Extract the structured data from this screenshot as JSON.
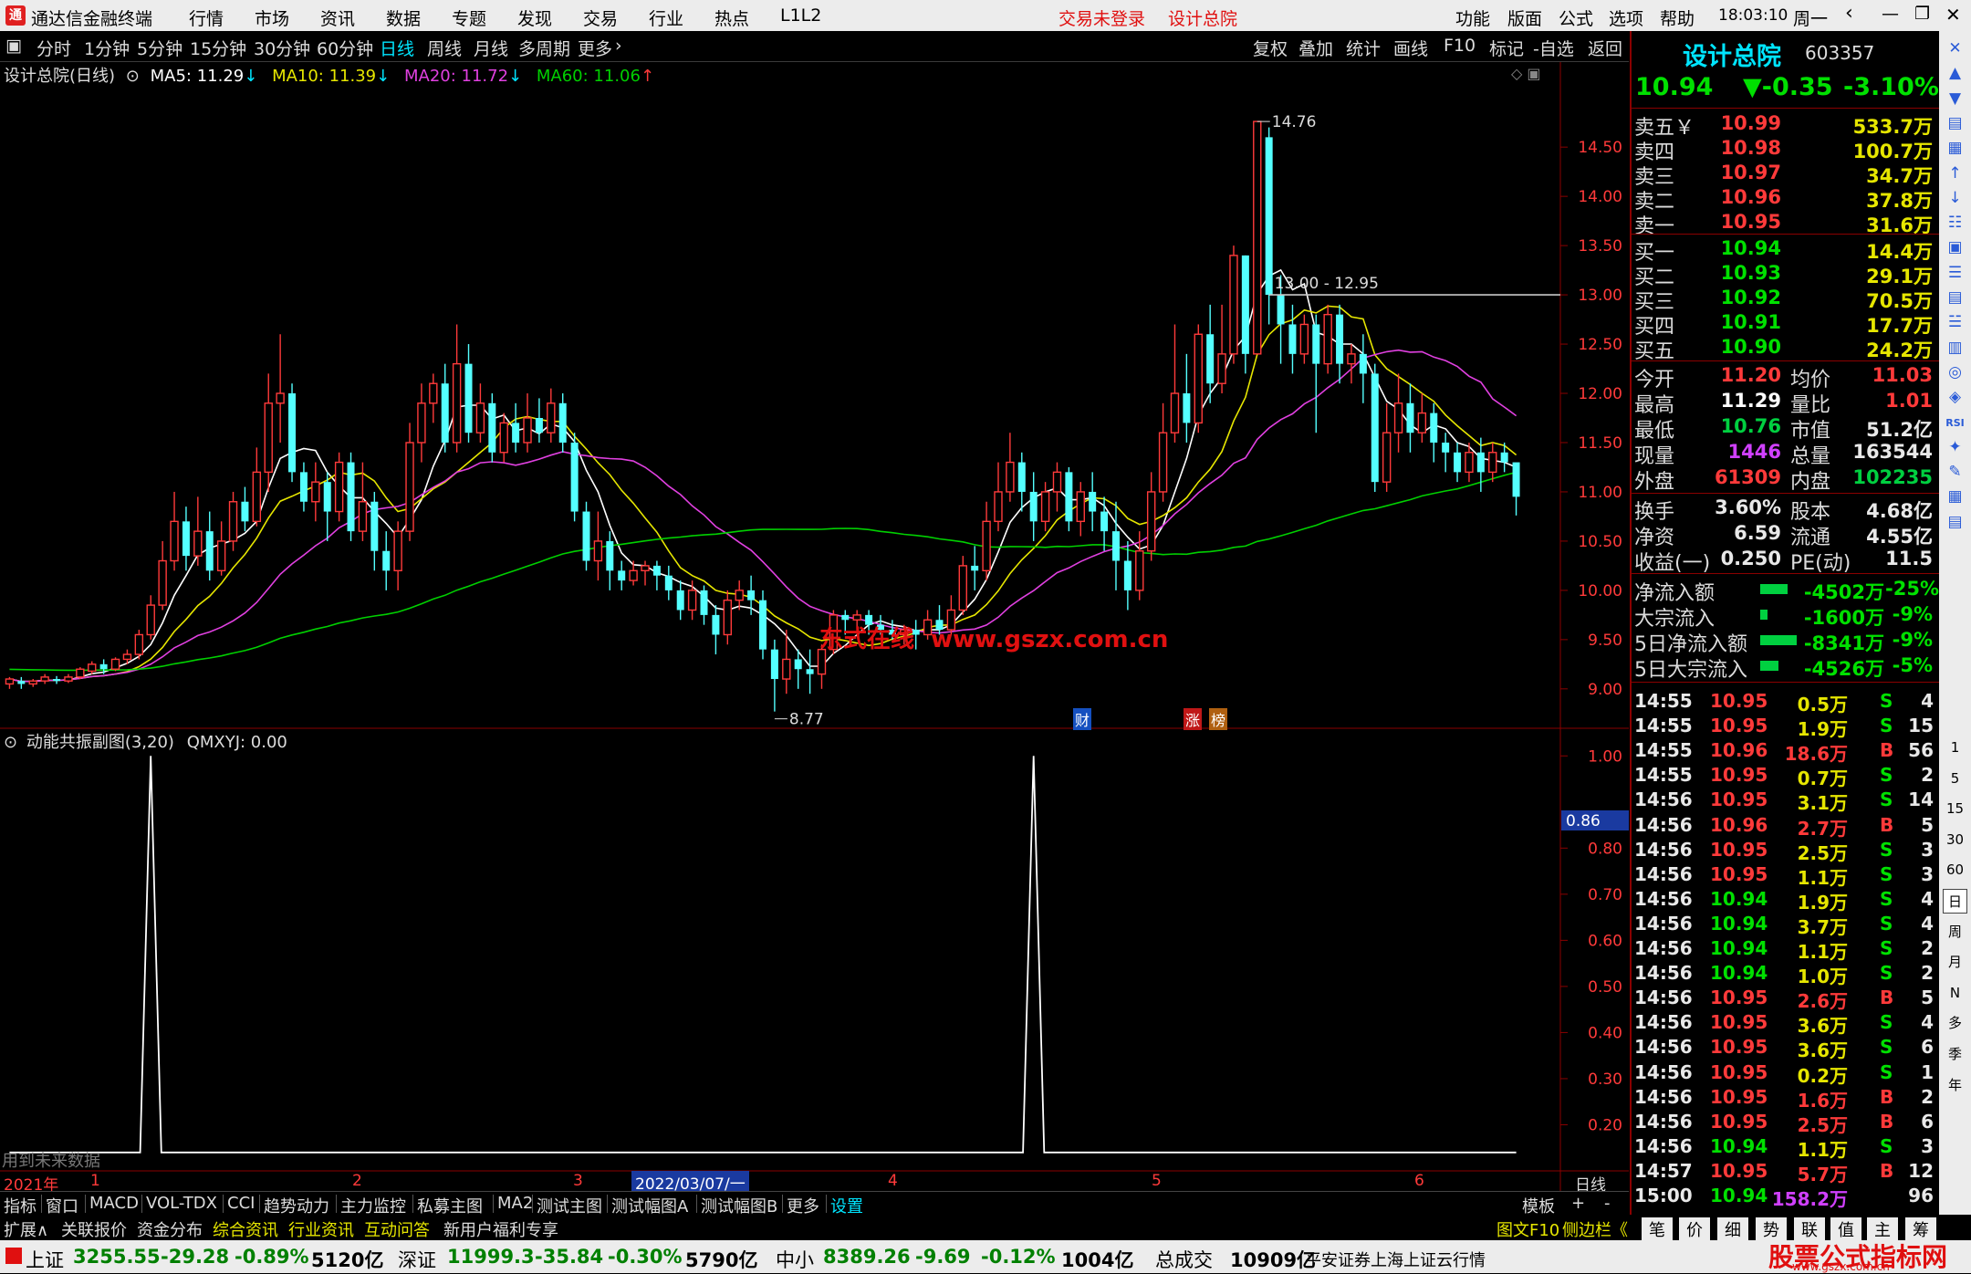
{
  "menu": {
    "app_title": "通达信金融终端",
    "items": [
      "行情",
      "市场",
      "资讯",
      "数据",
      "专题",
      "发现",
      "交易",
      "行业",
      "热点",
      "L1L2"
    ],
    "status_login": "交易未登录",
    "status_stock": "设计总院",
    "right_items": [
      "功能",
      "版面",
      "公式",
      "选项",
      "帮助"
    ],
    "clock": "18:03:10",
    "weekday": "周一"
  },
  "timeframes": [
    "分时",
    "1分钟",
    "5分钟",
    "15分钟",
    "30分钟",
    "60分钟",
    "日线",
    "周线",
    "月线",
    "多周期",
    "更多"
  ],
  "active_timeframe": "日线",
  "chart_tools": [
    "复权",
    "叠加",
    "统计",
    "画线",
    "F10",
    "标记",
    "-自选",
    "返回"
  ],
  "main_legend": {
    "title": "设计总院(日线)",
    "ma5": "MA5: 11.29",
    "ma10": "MA10: 11.39",
    "ma20": "MA20: 11.72",
    "ma60": "MA60: 11.06"
  },
  "annotations": {
    "high_label": "14.76",
    "low_label": "8.77",
    "price_line": "13.00 - 12.95",
    "watermark": "东式在线  www.gszx.com.cn",
    "badge1": "财",
    "badge2": "涨",
    "badge3": "榜"
  },
  "price_axis": [
    "14.50",
    "14.00",
    "13.50",
    "13.00",
    "12.50",
    "12.00",
    "11.50",
    "11.00",
    "10.50",
    "10.00",
    "9.50",
    "9.00"
  ],
  "sub_legend": {
    "title": "动能共振副图(3,20)",
    "value": "QMXYJ: 0.00",
    "note": "用到未来数据"
  },
  "sub_axis": [
    "1.00",
    "0.80",
    "0.70",
    "0.60",
    "0.50",
    "0.40",
    "0.30",
    "0.20"
  ],
  "sub_cursor_value": "0.86",
  "date_axis": {
    "year": "2021年",
    "months": [
      "1",
      "2",
      "3",
      "4",
      "5",
      "6"
    ],
    "cursor_date": "2022/03/07/一",
    "period": "日线"
  },
  "chart_data": {
    "type": "candlestick",
    "title": "设计总院(日线)",
    "ylim": [
      8.6,
      14.9
    ],
    "sub_ylim": [
      0.1,
      1.05
    ],
    "candles": [
      [
        9.05,
        9.1,
        9.0,
        9.12
      ],
      [
        9.08,
        9.05,
        9.0,
        9.12
      ],
      [
        9.05,
        9.08,
        9.02,
        9.1
      ],
      [
        9.08,
        9.12,
        9.05,
        9.15
      ],
      [
        9.1,
        9.08,
        9.05,
        9.13
      ],
      [
        9.08,
        9.12,
        9.06,
        9.15
      ],
      [
        9.12,
        9.2,
        9.1,
        9.22
      ],
      [
        9.18,
        9.25,
        9.15,
        9.28
      ],
      [
        9.25,
        9.2,
        9.15,
        9.3
      ],
      [
        9.2,
        9.3,
        9.18,
        9.32
      ],
      [
        9.3,
        9.35,
        9.25,
        9.4
      ],
      [
        9.35,
        9.55,
        9.3,
        9.6
      ],
      [
        9.55,
        9.85,
        9.5,
        9.95
      ],
      [
        9.85,
        10.3,
        9.8,
        10.5
      ],
      [
        10.3,
        10.7,
        10.2,
        11.0
      ],
      [
        10.7,
        10.35,
        10.2,
        10.85
      ],
      [
        10.35,
        10.6,
        10.25,
        10.95
      ],
      [
        10.6,
        10.2,
        10.1,
        10.8
      ],
      [
        10.2,
        10.5,
        10.15,
        10.7
      ],
      [
        10.5,
        10.9,
        10.4,
        11.0
      ],
      [
        10.9,
        10.7,
        10.6,
        11.05
      ],
      [
        10.7,
        11.2,
        10.65,
        11.45
      ],
      [
        11.2,
        11.9,
        11.0,
        12.2
      ],
      [
        11.9,
        12.0,
        11.5,
        12.6
      ],
      [
        12.0,
        11.2,
        11.1,
        12.1
      ],
      [
        11.2,
        10.9,
        10.8,
        11.3
      ],
      [
        10.9,
        11.1,
        10.7,
        11.3
      ],
      [
        11.1,
        10.8,
        10.5,
        11.2
      ],
      [
        10.8,
        11.3,
        10.7,
        11.4
      ],
      [
        11.3,
        10.6,
        10.5,
        11.4
      ],
      [
        10.6,
        10.9,
        10.5,
        11.3
      ],
      [
        10.9,
        10.4,
        10.2,
        11.0
      ],
      [
        10.4,
        10.2,
        10.0,
        10.6
      ],
      [
        10.2,
        10.6,
        10.0,
        10.7
      ],
      [
        10.6,
        11.5,
        10.5,
        11.7
      ],
      [
        11.5,
        11.9,
        11.3,
        12.1
      ],
      [
        11.9,
        12.1,
        11.7,
        12.2
      ],
      [
        12.1,
        11.5,
        11.4,
        12.3
      ],
      [
        11.5,
        12.3,
        11.4,
        12.7
      ],
      [
        12.3,
        11.6,
        11.5,
        12.5
      ],
      [
        11.6,
        11.9,
        11.5,
        12.1
      ],
      [
        11.9,
        11.4,
        11.3,
        12.0
      ],
      [
        11.4,
        11.7,
        11.3,
        11.8
      ],
      [
        11.7,
        11.5,
        11.4,
        11.9
      ],
      [
        11.5,
        11.75,
        11.4,
        12.0
      ],
      [
        11.75,
        11.6,
        11.5,
        11.95
      ],
      [
        11.6,
        11.9,
        11.5,
        12.05
      ],
      [
        11.9,
        11.5,
        11.4,
        12.0
      ],
      [
        11.5,
        10.8,
        10.7,
        11.6
      ],
      [
        10.8,
        10.3,
        10.2,
        10.9
      ],
      [
        10.3,
        10.5,
        10.1,
        10.8
      ],
      [
        10.5,
        10.2,
        10.0,
        10.6
      ],
      [
        10.2,
        10.1,
        10.0,
        10.3
      ],
      [
        10.1,
        10.2,
        10.05,
        10.3
      ],
      [
        10.2,
        10.25,
        10.05,
        10.3
      ],
      [
        10.25,
        10.15,
        10.0,
        10.3
      ],
      [
        10.15,
        10.0,
        9.9,
        10.25
      ],
      [
        10.0,
        9.8,
        9.7,
        10.1
      ],
      [
        9.8,
        10.0,
        9.7,
        10.1
      ],
      [
        10.0,
        9.75,
        9.65,
        10.05
      ],
      [
        9.75,
        9.55,
        9.35,
        9.85
      ],
      [
        9.55,
        9.9,
        9.45,
        10.0
      ],
      [
        9.9,
        10.0,
        9.8,
        10.1
      ],
      [
        10.0,
        9.9,
        9.75,
        10.15
      ],
      [
        9.9,
        9.4,
        9.3,
        10.0
      ],
      [
        9.4,
        9.1,
        8.77,
        9.5
      ],
      [
        9.1,
        9.3,
        8.95,
        9.6
      ],
      [
        9.3,
        9.2,
        9.0,
        9.4
      ],
      [
        9.2,
        9.15,
        8.95,
        9.4
      ],
      [
        9.15,
        9.4,
        9.0,
        9.45
      ],
      [
        9.4,
        9.75,
        9.35,
        9.8
      ],
      [
        9.75,
        9.7,
        9.55,
        9.8
      ],
      [
        9.7,
        9.75,
        9.6,
        9.8
      ],
      [
        9.75,
        9.65,
        9.55,
        9.8
      ],
      [
        9.65,
        9.6,
        9.55,
        9.75
      ],
      [
        9.6,
        9.55,
        9.5,
        9.7
      ],
      [
        9.55,
        9.6,
        9.45,
        9.65
      ],
      [
        9.6,
        9.55,
        9.4,
        9.7
      ],
      [
        9.55,
        9.7,
        9.5,
        9.8
      ],
      [
        9.7,
        9.6,
        9.55,
        9.85
      ],
      [
        9.6,
        9.8,
        9.55,
        9.95
      ],
      [
        9.8,
        10.25,
        9.75,
        10.35
      ],
      [
        10.25,
        10.2,
        10.0,
        10.45
      ],
      [
        10.2,
        10.7,
        10.1,
        10.9
      ],
      [
        10.7,
        11.0,
        10.6,
        11.3
      ],
      [
        11.0,
        11.3,
        10.9,
        11.6
      ],
      [
        11.3,
        11.0,
        10.8,
        11.4
      ],
      [
        11.0,
        10.7,
        10.5,
        11.2
      ],
      [
        10.7,
        11.0,
        10.6,
        11.1
      ],
      [
        11.0,
        11.2,
        10.8,
        11.3
      ],
      [
        11.2,
        10.7,
        10.6,
        11.25
      ],
      [
        10.7,
        11.0,
        10.55,
        11.1
      ],
      [
        11.0,
        10.8,
        10.6,
        11.2
      ],
      [
        10.8,
        10.6,
        10.4,
        10.95
      ],
      [
        10.6,
        10.3,
        10.0,
        10.9
      ],
      [
        10.3,
        10.0,
        9.8,
        10.5
      ],
      [
        10.0,
        10.4,
        9.9,
        10.6
      ],
      [
        10.4,
        11.0,
        10.3,
        11.2
      ],
      [
        11.0,
        11.6,
        10.9,
        11.9
      ],
      [
        11.6,
        12.0,
        11.5,
        12.7
      ],
      [
        12.0,
        11.7,
        11.5,
        12.4
      ],
      [
        11.7,
        12.6,
        11.6,
        12.7
      ],
      [
        12.6,
        12.1,
        11.9,
        12.9
      ],
      [
        12.1,
        12.4,
        12.0,
        12.9
      ],
      [
        12.4,
        13.4,
        12.3,
        13.5
      ],
      [
        13.4,
        12.4,
        12.2,
        13.4
      ],
      [
        12.4,
        14.76,
        12.5,
        14.76
      ],
      [
        14.6,
        13.0,
        12.7,
        14.7
      ],
      [
        13.0,
        12.7,
        12.3,
        13.2
      ],
      [
        12.7,
        12.4,
        12.2,
        12.9
      ],
      [
        12.4,
        12.7,
        12.3,
        12.8
      ],
      [
        12.7,
        12.3,
        11.6,
        12.8
      ],
      [
        12.3,
        12.8,
        12.2,
        12.9
      ],
      [
        12.8,
        12.3,
        12.1,
        12.9
      ],
      [
        12.3,
        12.4,
        12.1,
        12.5
      ],
      [
        12.4,
        12.2,
        11.9,
        12.6
      ],
      [
        12.2,
        11.1,
        11.0,
        12.3
      ],
      [
        11.1,
        11.6,
        11.0,
        11.9
      ],
      [
        11.6,
        11.9,
        11.4,
        12.2
      ],
      [
        11.9,
        11.6,
        11.4,
        12.1
      ],
      [
        11.6,
        11.8,
        11.5,
        12.0
      ],
      [
        11.8,
        11.5,
        11.3,
        11.9
      ],
      [
        11.5,
        11.4,
        11.2,
        11.6
      ],
      [
        11.4,
        11.2,
        11.1,
        11.5
      ],
      [
        11.2,
        11.4,
        11.1,
        11.5
      ],
      [
        11.4,
        11.2,
        11.0,
        11.55
      ],
      [
        11.2,
        11.4,
        11.1,
        11.5
      ],
      [
        11.4,
        11.3,
        11.2,
        11.5
      ],
      [
        11.3,
        10.95,
        10.76,
        11.29
      ]
    ],
    "spikes": [
      {
        "index": 12,
        "value": 1.0
      },
      {
        "index": 87,
        "value": 1.0
      }
    ]
  },
  "quote": {
    "name": "设计总院",
    "code": "603357",
    "price": "10.94",
    "change": "▼-0.35",
    "pct": "-3.10%",
    "asks": [
      {
        "label": "卖五￥",
        "price": "10.99",
        "vol": "533.7万"
      },
      {
        "label": "卖四",
        "price": "10.98",
        "vol": "100.7万"
      },
      {
        "label": "卖三",
        "price": "10.97",
        "vol": "34.7万"
      },
      {
        "label": "卖二",
        "price": "10.96",
        "vol": "37.8万"
      },
      {
        "label": "卖一",
        "price": "10.95",
        "vol": "31.6万"
      }
    ],
    "bids": [
      {
        "label": "买一",
        "price": "10.94",
        "vol": "14.4万"
      },
      {
        "label": "买二",
        "price": "10.93",
        "vol": "29.1万"
      },
      {
        "label": "买三",
        "price": "10.92",
        "vol": "70.5万"
      },
      {
        "label": "买四",
        "price": "10.91",
        "vol": "17.7万"
      },
      {
        "label": "买五",
        "price": "10.90",
        "vol": "24.2万"
      }
    ],
    "stats": [
      {
        "l1": "今开",
        "v1": "11.20",
        "l2": "均价",
        "v2": "11.03",
        "c1": "#ff3a3a",
        "c2": "#ff3a3a"
      },
      {
        "l1": "最高",
        "v1": "11.29",
        "l2": "量比",
        "v2": "1.01",
        "c1": "#ffffff",
        "c2": "#ff3a3a"
      },
      {
        "l1": "最低",
        "v1": "10.76",
        "l2": "市值",
        "v2": "51.2亿",
        "c1": "#00d040",
        "c2": "#e8e8e8"
      },
      {
        "l1": "现量",
        "v1": "1446",
        "l2": "总量",
        "v2": "163544",
        "c1": "#d040ff",
        "c2": "#e8e8e8"
      },
      {
        "l1": "外盘",
        "v1": "61309",
        "l2": "内盘",
        "v2": "102235",
        "c1": "#ff3a3a",
        "c2": "#00d040"
      }
    ],
    "stats2": [
      {
        "l1": "换手",
        "v1": "3.60%",
        "l2": "股本",
        "v2": "4.68亿"
      },
      {
        "l1": "净资",
        "v1": "6.59",
        "l2": "流通",
        "v2": "4.55亿"
      },
      {
        "l1": "收益(一)",
        "v1": "0.250",
        "l2": "PE(动)",
        "v2": "11.5"
      }
    ],
    "flows": [
      {
        "label": "净流入额",
        "value": "-4502万",
        "pct": "-25%",
        "bar": 0.12
      },
      {
        "label": "大宗流入",
        "value": "-1600万",
        "pct": "-9%",
        "bar": 0.03
      },
      {
        "label": "5日净流入额",
        "value": "-8341万",
        "pct": "-9%",
        "bar": 0.16
      },
      {
        "label": "5日大宗流入",
        "value": "-4526万",
        "pct": "-5%",
        "bar": 0.08
      }
    ],
    "ticks": [
      [
        "14:55",
        "10.95",
        "0.5万",
        "S",
        "4"
      ],
      [
        "14:55",
        "10.95",
        "1.9万",
        "S",
        "15"
      ],
      [
        "14:55",
        "10.96",
        "18.6万",
        "B",
        "56"
      ],
      [
        "14:55",
        "10.95",
        "0.7万",
        "S",
        "2"
      ],
      [
        "14:56",
        "10.95",
        "3.1万",
        "S",
        "14"
      ],
      [
        "14:56",
        "10.96",
        "2.7万",
        "B",
        "5"
      ],
      [
        "14:56",
        "10.95",
        "2.5万",
        "S",
        "3"
      ],
      [
        "14:56",
        "10.95",
        "1.1万",
        "S",
        "3"
      ],
      [
        "14:56",
        "10.94",
        "1.9万",
        "S",
        "4"
      ],
      [
        "14:56",
        "10.94",
        "3.7万",
        "S",
        "4"
      ],
      [
        "14:56",
        "10.94",
        "1.1万",
        "S",
        "2"
      ],
      [
        "14:56",
        "10.94",
        "1.0万",
        "S",
        "2"
      ],
      [
        "14:56",
        "10.95",
        "2.6万",
        "B",
        "5"
      ],
      [
        "14:56",
        "10.95",
        "3.6万",
        "S",
        "4"
      ],
      [
        "14:56",
        "10.95",
        "3.6万",
        "S",
        "6"
      ],
      [
        "14:56",
        "10.95",
        "0.2万",
        "S",
        "1"
      ],
      [
        "14:56",
        "10.95",
        "1.6万",
        "B",
        "2"
      ],
      [
        "14:56",
        "10.95",
        "2.5万",
        "B",
        "6"
      ],
      [
        "14:56",
        "10.94",
        "1.1万",
        "S",
        "3"
      ],
      [
        "14:57",
        "10.95",
        "5.7万",
        "B",
        "12"
      ],
      [
        "15:00",
        "10.94",
        "158.2万",
        "",
        "96"
      ]
    ]
  },
  "vtoolbar": {
    "items": [
      "✕",
      "▲",
      "▼",
      "▤",
      "▦",
      "↑",
      "↓",
      "☷",
      "▣",
      "☰",
      "▤",
      "☱",
      "▥",
      "◎",
      "◈",
      "RSI",
      "✦",
      "✎",
      "▦",
      "▤"
    ],
    "periods": [
      "1",
      "5",
      "15",
      "30",
      "60",
      "日",
      "周",
      "月",
      "N",
      "多",
      "季",
      "年"
    ]
  },
  "tabs_row1": [
    "指标",
    "窗口",
    "MACD",
    "VOL-TDX",
    "CCI",
    "趋势动力",
    "主力监控",
    "私募主图",
    "MA2",
    "测试主图",
    "测试幅图A",
    "测试幅图B",
    "更多",
    "设置"
  ],
  "tabs_row1_right": [
    "模板",
    "+",
    "-"
  ],
  "tabs_row2": [
    "扩展∧",
    "关联报价",
    "资金分布",
    "综合资讯",
    "行业资讯",
    "互动问答",
    "新用户福利专享"
  ],
  "tabs_row2_right": [
    "图文F10",
    "侧边栏《",
    "笔",
    "价",
    "细",
    "势",
    "联",
    "值",
    "主",
    "筹"
  ],
  "status": {
    "sh_label": "上证",
    "sh_val": "3255.55",
    "sh_chg": "-29.28",
    "sh_pct": "-0.89%",
    "sh_amt": "5120亿",
    "sz_label": "深证",
    "sz_val": "11999.3",
    "sz_chg": "-35.84",
    "sz_pct": "-0.30%",
    "sz_amt": "5790亿",
    "zx_label": "中小",
    "zx_val": "8389.26",
    "zx_chg": "-9.69",
    "zx_pct": "-0.12%",
    "zx_amt": "1004亿",
    "total_label": "总成交",
    "total_val": "10909亿",
    "broker": "平安证券上海上证云行情",
    "brand": "股票公式指标网",
    "brand_url": "www.gszx.com.cn"
  },
  "colors": {
    "up": "#ff3a3a",
    "down": "#54ffff",
    "ma5": "#ffffff",
    "ma10": "#e6e600",
    "ma20": "#e040e0",
    "ma60": "#00d000",
    "grid": "#8a0000",
    "accent": "#00e5ff"
  }
}
